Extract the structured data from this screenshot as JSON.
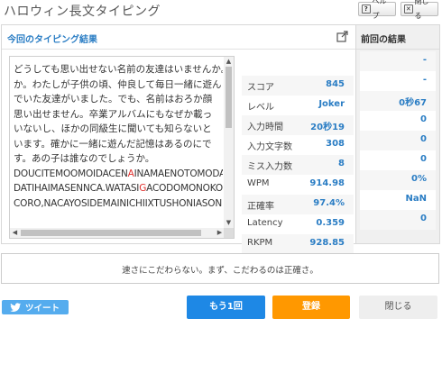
{
  "app": {
    "title": "ハロウィン長文タイピング"
  },
  "header": {
    "help_label": "ヘルプ",
    "close_label": "閉じる"
  },
  "result": {
    "title": "今回のタイピング結果",
    "text_lines": [
      {
        "segments": [
          "どうしても思い出せない名前の友達はいませんか。"
        ]
      },
      {
        "segments": [
          "か。わたしが子供の頃、仲良して毎日一緒に遊ん"
        ]
      },
      {
        "segments": [
          "でいた友達がいました。でも、名前はおろか顔"
        ]
      },
      {
        "segments": [
          "思い出せません。卒業アルバムにもなぜか載っ"
        ]
      },
      {
        "segments": [
          "いないし、ほかの同級生に聞いても知らないと"
        ]
      },
      {
        "segments": [
          "います。確かに一緒に遊んだ記憶はあるのにで"
        ]
      },
      {
        "segments": [
          "す。あの子は誰なのでしょうか。"
        ]
      },
      {
        "segments": [
          "DOUCITEMOOMOIDACEN",
          "A",
          "INAMAENOTOMODACIHAIMASENKA."
        ],
        "error_index": 1
      },
      {
        "segments": [
          "DATIHAIMASENNCA.WATASI",
          "G",
          "ACODOMONOKORO,"
        ],
        "error_index": 1
      },
      {
        "segments": [
          "CORO,NACAYOSIDEMAINICHIIXTUSHONIASONNDEIMASITA"
        ]
      }
    ],
    "stats": [
      {
        "label": "スコア",
        "value": "845"
      },
      {
        "label": "レベル",
        "value": "Joker"
      },
      {
        "label": "入力時間",
        "value": "20秒19"
      },
      {
        "label": "入力文字数",
        "value": "308"
      },
      {
        "label": "ミス入力数",
        "value": "8"
      },
      {
        "label": "WPM",
        "value": "914.98"
      },
      {
        "label": "正確率",
        "value": "97.4%"
      },
      {
        "label": "Latency",
        "value": "0.359"
      },
      {
        "label": "RKPM",
        "value": "928.85"
      }
    ]
  },
  "previous": {
    "title": "前回の結果",
    "values": [
      "-",
      "-",
      "0秒67",
      "0",
      "0",
      "0",
      "0%",
      "NaN",
      "0"
    ]
  },
  "message": "速さにこだわらない。まず、こだわるのは正確さ。",
  "buttons": {
    "tweet": "ツイート",
    "retry": "もう1回",
    "register": "登録",
    "close": "閉じる"
  },
  "colors": {
    "accent": "#2a7dc4",
    "retry": "#1e88e5",
    "register": "#ff9800",
    "tweet": "#55acee",
    "error": "#e0312e"
  }
}
